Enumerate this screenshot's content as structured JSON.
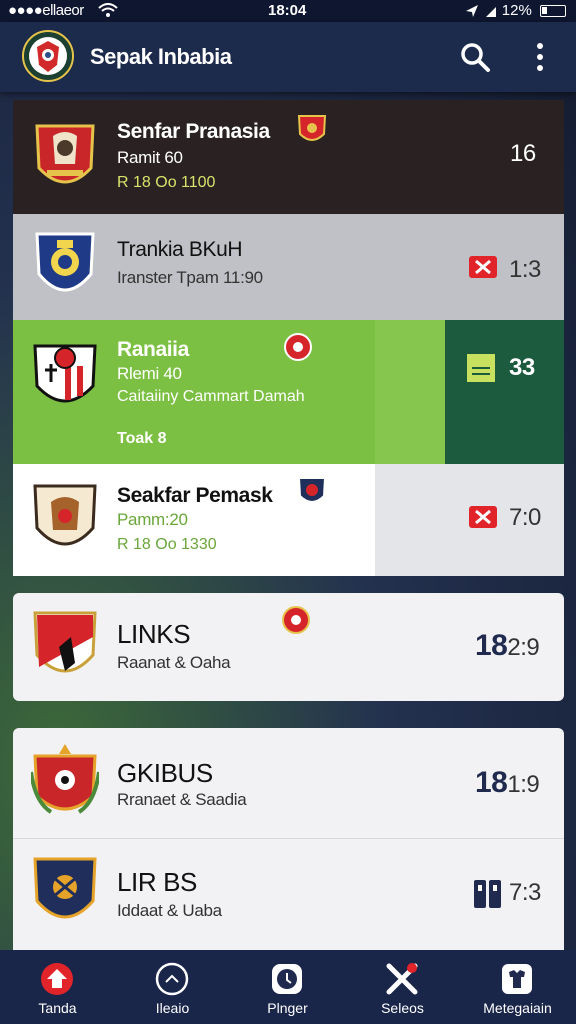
{
  "status_bar": {
    "carrier": "●●●●ellaeor",
    "time": "18:04",
    "battery": "12%"
  },
  "app_bar": {
    "title": "Sepak Inbabia"
  },
  "matches": [
    {
      "title": "Senfar Pranasia",
      "line2": "Ramit 60",
      "line3": "R 18  Oo 1100",
      "score": "16"
    },
    {
      "title": "Trankia BKuH",
      "line2": "Iranster Tpam 11:90",
      "score": "1:3"
    },
    {
      "title": "Ranaiia",
      "line2": "Rlemi 40",
      "line3": "Caitaiiny Cammart  Damah",
      "line4": "Toak 8",
      "score": "33"
    },
    {
      "title": "Seakfar Pemask",
      "line2": "Pamm:20",
      "line3": "R 18  Oo 1330",
      "score": "7:0"
    },
    {
      "title": "LINKS",
      "line2": "Raanat & Oaha",
      "score_bold": "18",
      "score": "2:9"
    },
    {
      "title": "GKIBUS",
      "line2": "Rranaet & Saadia",
      "score_bold": "18",
      "score": "1:9"
    },
    {
      "title": "LIR BS",
      "line2": "Iddaat & Uaba",
      "score": "7:3"
    }
  ],
  "nav": [
    {
      "label": "Tanda"
    },
    {
      "label": "Ileaio"
    },
    {
      "label": "Plnger"
    },
    {
      "label": "Seleos"
    },
    {
      "label": "Metegaiain"
    }
  ],
  "colors": {
    "app_bar": "#1c2a4c",
    "active_row": "#7cc043",
    "score_panel": "#1d5b3f",
    "nav": "#19264a",
    "accent_red": "#e0242a"
  }
}
